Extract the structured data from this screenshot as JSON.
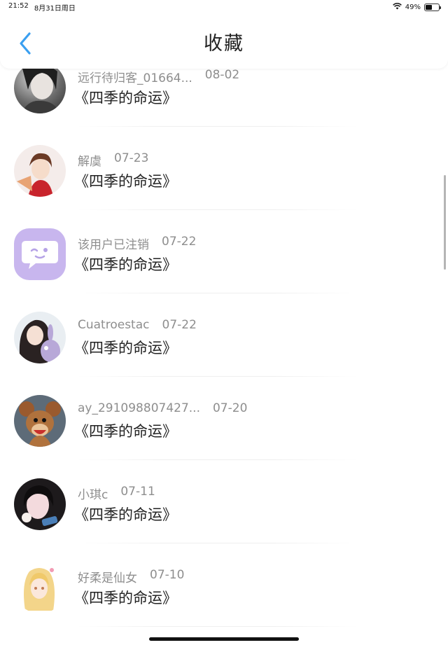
{
  "status": {
    "time": "21:52",
    "date": "8月31日周日",
    "battery": "49%",
    "battery_level": 0.49
  },
  "nav": {
    "title": "收藏",
    "back_icon": "chevron-left-icon",
    "accent": "#3a9ff0"
  },
  "items": [
    {
      "user": "远行待归客_01664...",
      "date": "08-02",
      "title": "《四季的命运》",
      "avatar": "photo-avatar"
    },
    {
      "user": "解虞",
      "date": "07-23",
      "title": "《四季的命运》",
      "avatar": "anime-avatar"
    },
    {
      "user": "该用户已注销",
      "date": "07-22",
      "title": "《四季的命运》",
      "avatar": "chat-bubble-avatar"
    },
    {
      "user": "Cuatroestac",
      "date": "07-22",
      "title": "《四季的命运》",
      "avatar": "photo-avatar"
    },
    {
      "user": "ay_291098807427...",
      "date": "07-20",
      "title": "《四季的命运》",
      "avatar": "cartoon-mouse-avatar"
    },
    {
      "user": "小琪c",
      "date": "07-11",
      "title": "《四季的命运》",
      "avatar": "photo-avatar"
    },
    {
      "user": "好柔是仙女",
      "date": "07-10",
      "title": "《四季的命运》",
      "avatar": "anime-avatar"
    }
  ]
}
